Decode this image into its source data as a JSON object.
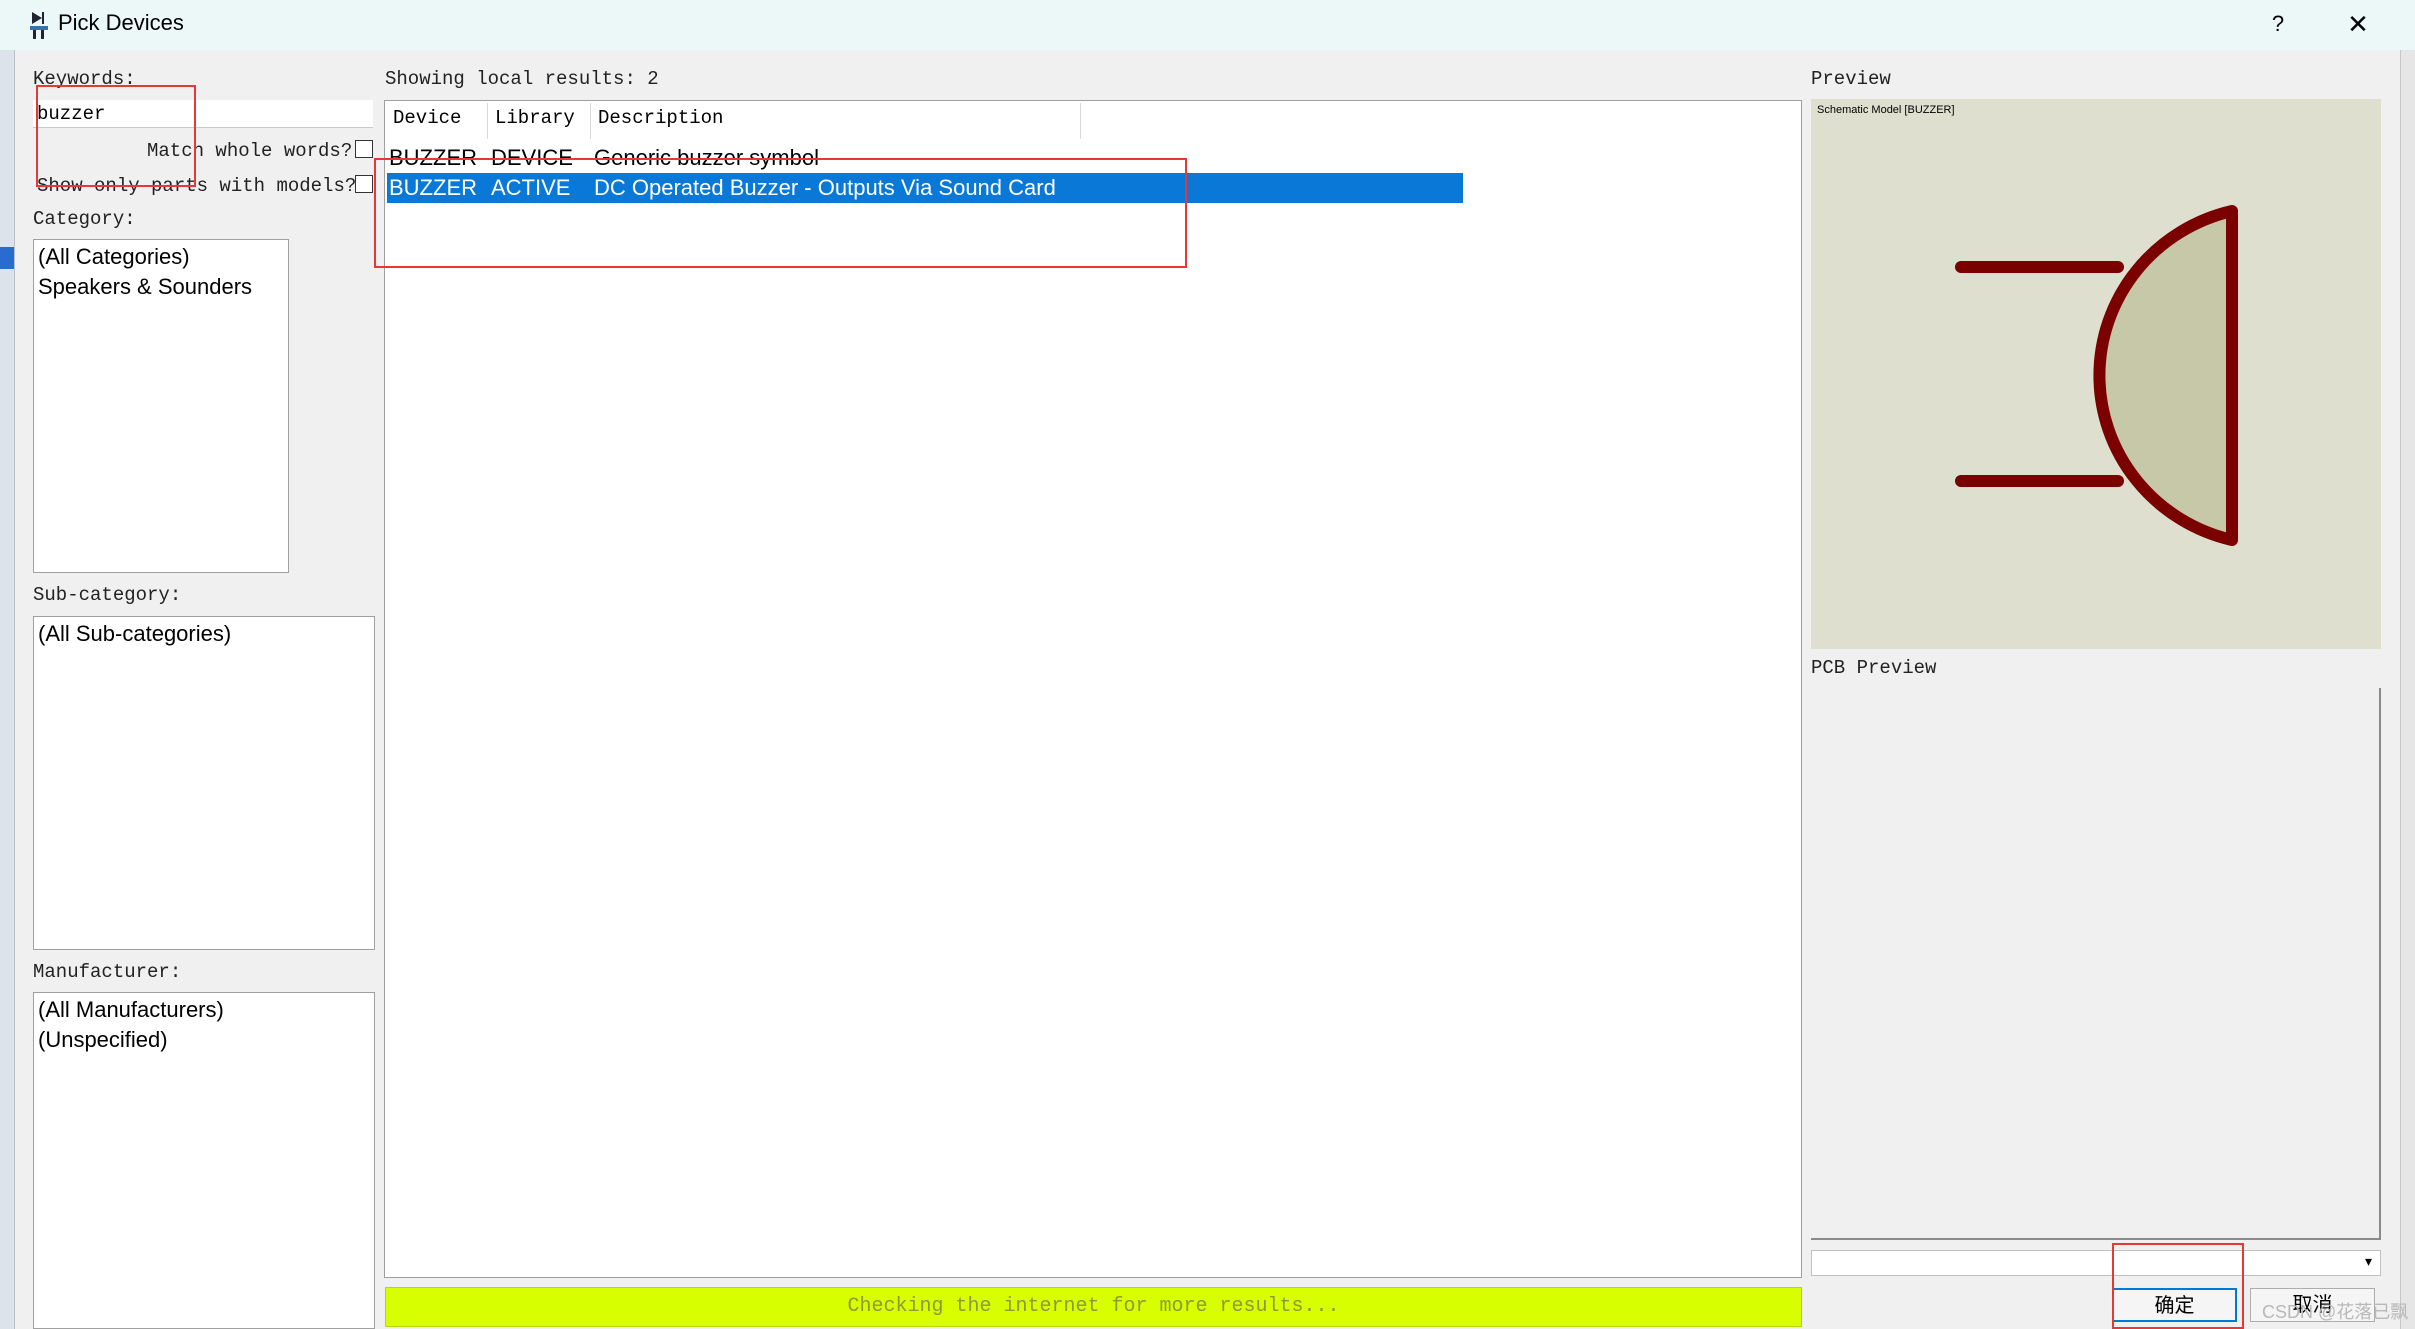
{
  "window": {
    "title": "Pick Devices",
    "help_label": "?",
    "close_label": "✕"
  },
  "left": {
    "keywords_label": "Keywords:",
    "keywords_value": "buzzer",
    "match_whole_words_label": "Match whole words?",
    "show_only_models_label": "Show only parts with models?",
    "category_label": "Category:",
    "categories": [
      "(All Categories)",
      "Speakers & Sounders"
    ],
    "subcategory_label": "Sub-category:",
    "subcategories": [
      "(All Sub-categories)"
    ],
    "manufacturer_label": "Manufacturer:",
    "manufacturers": [
      "(All Manufacturers)",
      "(Unspecified)"
    ]
  },
  "results": {
    "summary": "Showing local results: 2",
    "columns": {
      "device": "Device",
      "library": "Library",
      "description": "Description"
    },
    "rows": [
      {
        "device": "BUZZER",
        "library": "DEVICE",
        "description": "Generic buzzer symbol"
      },
      {
        "device": "BUZZER",
        "library": "ACTIVE",
        "description": "DC Operated Buzzer - Outputs Via Sound Card"
      }
    ],
    "selected_row": 2,
    "status": "Checking the internet for more results..."
  },
  "preview": {
    "label": "Preview",
    "model_label": "Schematic Model [BUZZER]",
    "pcb_label": "PCB Preview",
    "symbol_fill": "#c7c8a8",
    "symbol_stroke": "#7b0000"
  },
  "buttons": {
    "ok": "确定",
    "cancel": "取消"
  },
  "watermark": "CSDN @花落已飘",
  "colors": {
    "selection": "#0a78d7",
    "status_bg": "#d7ff00",
    "annotation": "#e53935"
  }
}
